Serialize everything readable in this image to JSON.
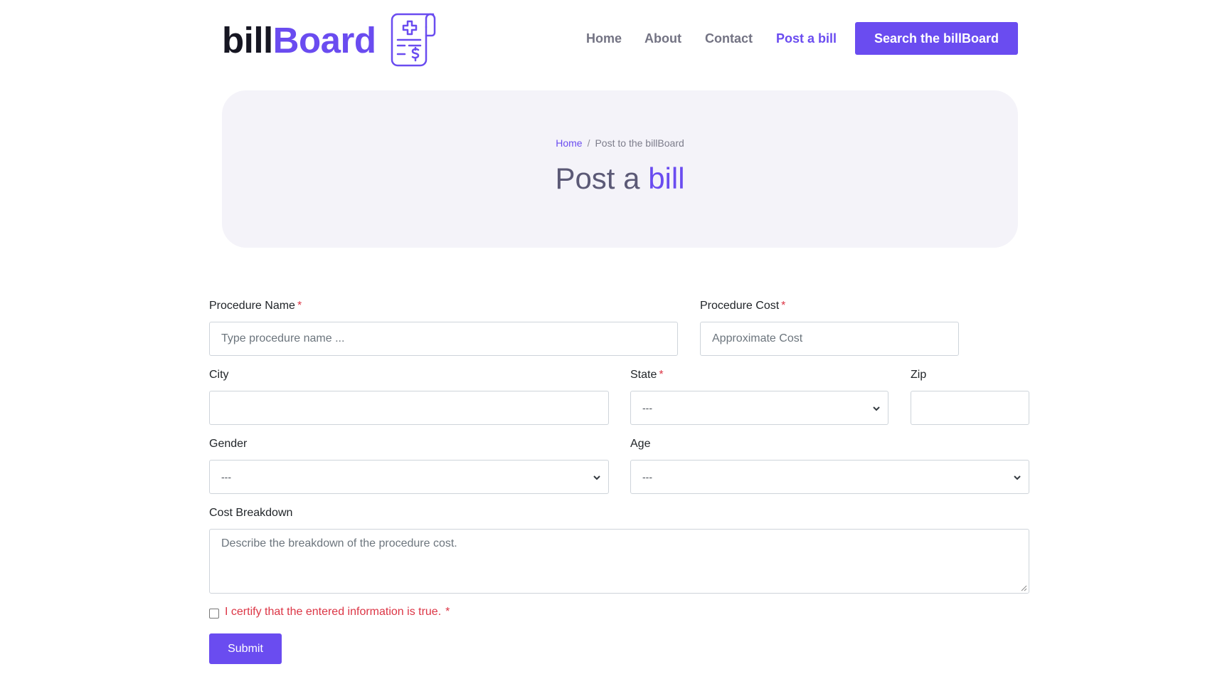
{
  "brand": {
    "name_part1": "bill",
    "name_part2": "Board",
    "logo_icon": "medical-bill-icon"
  },
  "nav": {
    "links": [
      {
        "label": "Home"
      },
      {
        "label": "About"
      },
      {
        "label": "Contact"
      },
      {
        "label": "Post a bill",
        "active": true
      }
    ],
    "cta_label": "Search the billBoard"
  },
  "hero": {
    "breadcrumb": {
      "home": "Home",
      "separator": "/",
      "current": "Post to the billBoard"
    },
    "title_prefix": "Post a",
    "title_accent": "bill"
  },
  "form": {
    "procedure_name": {
      "label": "Procedure Name",
      "required_mark": "*",
      "placeholder": "Type procedure name ...",
      "value": ""
    },
    "procedure_cost": {
      "label": "Procedure Cost",
      "required_mark": "*",
      "placeholder": "Approximate Cost",
      "value": ""
    },
    "city": {
      "label": "City",
      "value": ""
    },
    "state": {
      "label": "State",
      "required_mark": "*",
      "selected": "---"
    },
    "zip": {
      "label": "Zip",
      "value": ""
    },
    "gender": {
      "label": "Gender",
      "selected": "---"
    },
    "age": {
      "label": "Age",
      "selected": "---"
    },
    "cost_breakdown": {
      "label": "Cost Breakdown",
      "placeholder": "Describe the breakdown of the procedure cost."
    },
    "certify": {
      "label": "I certify that the entered information is true.",
      "required_mark": "*",
      "checked": false
    },
    "submit_label": "Submit"
  },
  "colors": {
    "accent": "#6a4cf0",
    "nav_text": "#737383",
    "hero_bg": "#f4f3f9",
    "required": "#dc3545"
  }
}
